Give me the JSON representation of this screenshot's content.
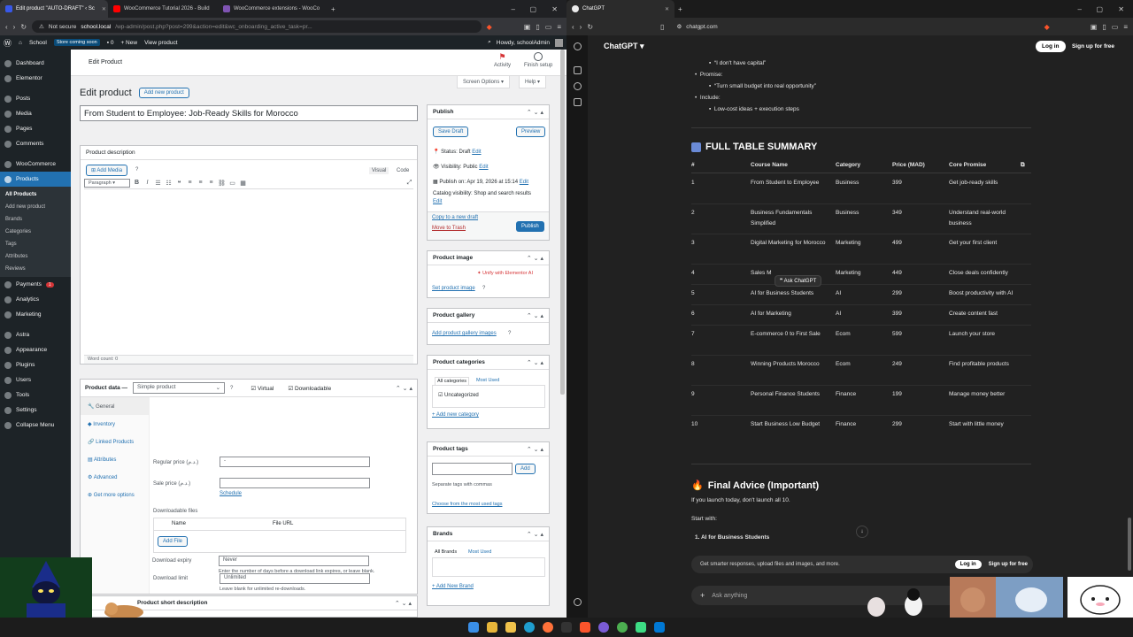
{
  "left_browser": {
    "tabs": [
      {
        "title": "Edit product \"AUTO-DRAFT\" ‹ Sc",
        "color": "#3858e9",
        "active": true
      },
      {
        "title": "WooCommerce Tutorial 2026 - Build",
        "color": "#ff0000",
        "active": false
      },
      {
        "title": "WooCommerce extensions - WooCo",
        "color": "#7f54b3",
        "active": false
      }
    ],
    "security_label": "Not secure",
    "url_host": "school.local",
    "url_path": "/wp-admin/post.php?post=299&action=edit&wc_onboarding_active_task=pr..."
  },
  "admin_bar": {
    "site_name": "School",
    "store_badge": "Store coming soon",
    "comments_count": "0",
    "new_label": "New",
    "view_label": "View product",
    "howdy": "Howdy, schoolAdmin"
  },
  "sidebar": {
    "items": [
      {
        "label": "Dashboard"
      },
      {
        "label": "Elementor"
      },
      {
        "label": "Posts"
      },
      {
        "label": "Media"
      },
      {
        "label": "Pages"
      },
      {
        "label": "Comments"
      },
      {
        "label": "WooCommerce"
      },
      {
        "label": "Products"
      }
    ],
    "submenu": [
      "All Products",
      "Add new product",
      "Brands",
      "Categories",
      "Tags",
      "Attributes",
      "Reviews"
    ],
    "items2": [
      {
        "label": "Payments",
        "badge": "1"
      },
      {
        "label": "Analytics"
      },
      {
        "label": "Marketing"
      },
      {
        "label": "Astra"
      },
      {
        "label": "Appearance"
      },
      {
        "label": "Plugins"
      },
      {
        "label": "Users"
      },
      {
        "label": "Tools"
      },
      {
        "label": "Settings"
      },
      {
        "label": "Collapse Menu"
      }
    ]
  },
  "header": {
    "page_label": "Edit Product",
    "activity": "Activity",
    "finish_setup": "Finish setup",
    "screen_options": "Screen Options ▾",
    "help": "Help ▾",
    "heading": "Edit product",
    "add_new": "Add new product"
  },
  "product_title": "From Student to Employee: Job-Ready Skills for Morocco",
  "description_box": {
    "title": "Product description",
    "add_media": "Add Media",
    "visual_tab": "Visual",
    "code_tab": "Code",
    "format_select": "Paragraph",
    "word_count": "Word count: 0"
  },
  "product_data": {
    "title": "Product data —",
    "type_select": "Simple product",
    "virtual_label": "Virtual",
    "downloadable_label": "Downloadable",
    "tabs": [
      "General",
      "Inventory",
      "Linked Products",
      "Attributes",
      "Advanced",
      "Get more options"
    ],
    "regular_price_label": "Regular price (د.م.)",
    "regular_price_value": "-",
    "sale_price_label": "Sale price (د.م.)",
    "schedule_link": "Schedule",
    "downloadable_files_label": "Downloadable files",
    "name_col": "Name",
    "file_url_col": "File URL",
    "add_file": "Add File",
    "download_limit_label": "Download limit",
    "download_limit_placeholder": "Unlimited",
    "download_limit_help": "Leave blank for unlimited re-downloads.",
    "download_expiry_label": "Download expiry",
    "download_expiry_placeholder": "Never",
    "download_expiry_help": "Enter the number of days before a download link expires, or leave blank.",
    "short_desc_title": "Product short description"
  },
  "publish": {
    "title": "Publish",
    "save_draft": "Save Draft",
    "preview": "Preview",
    "status": "Status: Draft",
    "status_edit": "Edit",
    "visibility": "Visibility: Public",
    "visibility_edit": "Edit",
    "publish_on": "Publish on: Apr 19, 2026 at 15:14",
    "publish_edit": "Edit",
    "catalog": "Catalog visibility: Shop and search results",
    "catalog_edit": "Edit",
    "copy_draft": "Copy to a new draft",
    "trash": "Move to Trash",
    "publish_btn": "Publish"
  },
  "product_image": {
    "title": "Product image",
    "elementor_ai": "Unify with Elementor AI",
    "set_link": "Set product image"
  },
  "product_gallery": {
    "title": "Product gallery",
    "add_link": "Add product gallery images"
  },
  "product_categories": {
    "title": "Product categories",
    "tab_all": "All categories",
    "tab_most": "Most Used",
    "item": "Uncategorized",
    "add_new": "+ Add new category"
  },
  "product_tags": {
    "title": "Product tags",
    "add_btn": "Add",
    "help": "Separate tags with commas",
    "choose": "Choose from the most used tags"
  },
  "brands": {
    "title": "Brands",
    "tab_all": "All Brands",
    "tab_most": "Most Used",
    "add_new": "+ Add New Brand"
  },
  "right_browser": {
    "tab_title": "ChatGPT",
    "url": "chatgpt.com"
  },
  "chatgpt": {
    "model": "ChatGPT ▾",
    "login": "Log in",
    "signup": "Sign up for free",
    "bullets": [
      {
        "text": "“I don't have capital”",
        "level": 2
      },
      {
        "text": "Promise:",
        "level": 1
      },
      {
        "text": "“Turn small budget into real opportunity”",
        "level": 2
      },
      {
        "text": "Include:",
        "level": 1
      },
      {
        "text": "Low-cost ideas + execution steps",
        "level": 2
      }
    ],
    "table_heading": "FULL TABLE SUMMARY",
    "table_columns": [
      "#",
      "Course Name",
      "Category",
      "Price (MAD)",
      "Core Promise"
    ],
    "table_rows": [
      [
        "1",
        "From Student to Employee",
        "Business",
        "399",
        "Get job-ready skills"
      ],
      [
        "2",
        "Business Fundamentals Simplified",
        "Business",
        "349",
        "Understand real-world business"
      ],
      [
        "3",
        "Digital Marketing for Morocco",
        "Marketing",
        "499",
        "Get your first client"
      ],
      [
        "4",
        "Sales M",
        "Marketing",
        "449",
        "Close deals confidently"
      ],
      [
        "5",
        "AI for Business Students",
        "AI",
        "299",
        "Boost productivity with AI"
      ],
      [
        "6",
        "AI for Marketing",
        "AI",
        "399",
        "Create content fast"
      ],
      [
        "7",
        "E-commerce 0 to First Sale",
        "Ecom",
        "599",
        "Launch your store"
      ],
      [
        "8",
        "Winning Products Morocco",
        "Ecom",
        "249",
        "Find profitable products"
      ],
      [
        "9",
        "Personal Finance Students",
        "Finance",
        "199",
        "Manage money better"
      ],
      [
        "10",
        "Start Business Low Budget",
        "Finance",
        "299",
        "Start with little money"
      ]
    ],
    "ask_tooltip": "Ask ChatGPT",
    "advice_heading": "Final Advice (Important)",
    "advice_line": "If you launch today, don't launch all 10.",
    "start_with": "Start with:",
    "numbered_1": "1.  AI for Business Students",
    "banner_text": "Get smarter responses, upload files and images, and more.",
    "banner_login": "Log in",
    "banner_signup": "Sign up for free",
    "ask_placeholder": "Ask anything"
  },
  "colors": {
    "wp_blue": "#2271b1",
    "wp_dark": "#1d2327",
    "cg_bg": "#212121"
  }
}
